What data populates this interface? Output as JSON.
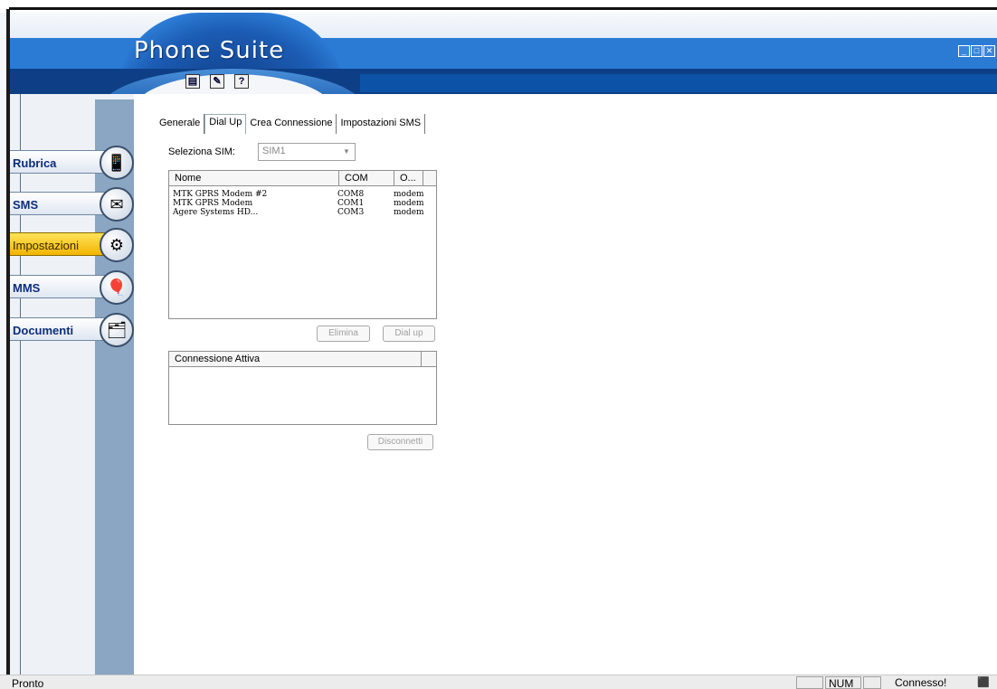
{
  "app": {
    "title": "Phone Suite",
    "window_controls": [
      "_",
      "□",
      "✕"
    ]
  },
  "toolbar": {
    "buttons": [
      {
        "name": "save-icon",
        "glyph": "▤"
      },
      {
        "name": "edit-icon",
        "glyph": "✎"
      },
      {
        "name": "help-icon",
        "glyph": "?"
      }
    ]
  },
  "sidebar": {
    "items": [
      {
        "label": "Rubrica",
        "icon": "phone-icon",
        "glyph": "📱",
        "active": false
      },
      {
        "label": "SMS",
        "icon": "envelope-icon",
        "glyph": "✉",
        "active": false
      },
      {
        "label": "Impostazioni",
        "icon": "settings-icon",
        "glyph": "⚙",
        "active": true
      },
      {
        "label": "MMS",
        "icon": "balloon-icon",
        "glyph": "🎈",
        "active": false
      },
      {
        "label": "Documenti",
        "icon": "folder-icon",
        "glyph": "🗂",
        "active": false
      }
    ]
  },
  "tabs": [
    "Generale",
    "Dial Up",
    "Crea Connessione",
    "Impostazioni SMS"
  ],
  "active_tab": "Dial Up",
  "sim": {
    "label": "Seleziona SIM:",
    "value": "SIM1"
  },
  "modems": {
    "columns": [
      "Nome",
      "COM",
      "O..."
    ],
    "rows": [
      {
        "name": "MTK GPRS Modem #2",
        "com": "COM8",
        "type": "modem"
      },
      {
        "name": "MTK GPRS Modem",
        "com": "COM1",
        "type": "modem"
      },
      {
        "name": "Agere Systems HD...",
        "com": "COM3",
        "type": "modem"
      }
    ]
  },
  "buttons": {
    "elimina": "Elimina",
    "dialup": "Dial up",
    "disconnetti": "Disconnetti"
  },
  "active_connection": {
    "column": "Connessione Attiva"
  },
  "status": {
    "left": "Pronto",
    "num": "NUM",
    "connection": "Connesso!"
  }
}
